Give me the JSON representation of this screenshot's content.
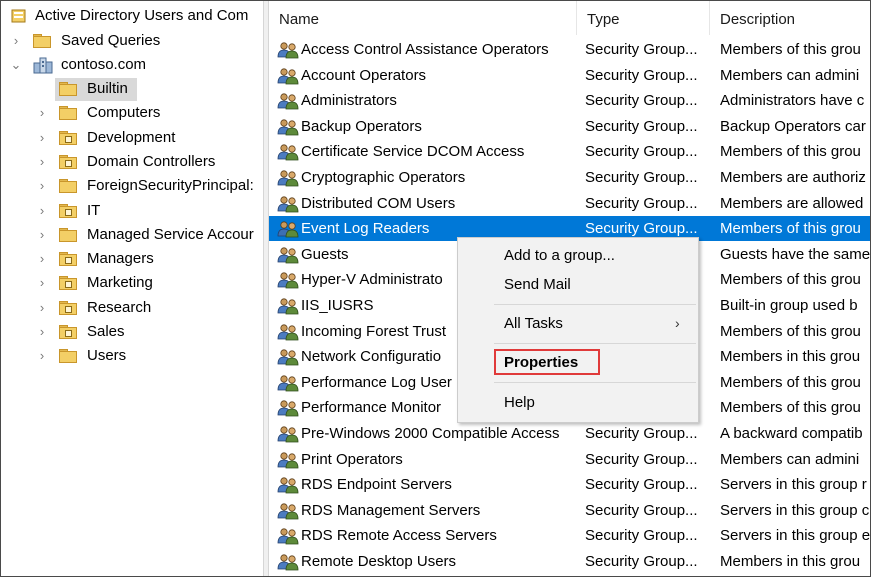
{
  "tree": {
    "root_label": "Active Directory Users and Com",
    "saved_queries": "Saved Queries",
    "domain": "contoso.com",
    "children": [
      {
        "label": "Builtin",
        "icon": "folder-icon",
        "selected": true
      },
      {
        "label": "Computers",
        "icon": "folder-icon"
      },
      {
        "label": "Development",
        "icon": "ou-folder-icon"
      },
      {
        "label": "Domain Controllers",
        "icon": "ou-folder-icon"
      },
      {
        "label": "ForeignSecurityPrincipal:",
        "icon": "folder-icon"
      },
      {
        "label": "IT",
        "icon": "ou-folder-icon"
      },
      {
        "label": "Managed Service Accour",
        "icon": "folder-icon"
      },
      {
        "label": "Managers",
        "icon": "ou-folder-icon"
      },
      {
        "label": "Marketing",
        "icon": "ou-folder-icon"
      },
      {
        "label": "Research",
        "icon": "ou-folder-icon"
      },
      {
        "label": "Sales",
        "icon": "ou-folder-icon"
      },
      {
        "label": "Users",
        "icon": "folder-icon"
      }
    ]
  },
  "list": {
    "columns": [
      "Name",
      "Type",
      "Description"
    ],
    "rows": [
      {
        "name": "Access Control Assistance Operators",
        "type": "Security Group...",
        "desc": "Members of this grou"
      },
      {
        "name": "Account Operators",
        "type": "Security Group...",
        "desc": "Members can admini"
      },
      {
        "name": "Administrators",
        "type": "Security Group...",
        "desc": "Administrators have c"
      },
      {
        "name": "Backup Operators",
        "type": "Security Group...",
        "desc": "Backup Operators car"
      },
      {
        "name": "Certificate Service DCOM Access",
        "type": "Security Group...",
        "desc": "Members of this grou"
      },
      {
        "name": "Cryptographic Operators",
        "type": "Security Group...",
        "desc": "Members are authoriz"
      },
      {
        "name": "Distributed COM Users",
        "type": "Security Group...",
        "desc": "Members are allowed"
      },
      {
        "name": "Event Log Readers",
        "type": "Security Group...",
        "desc": "Members of this grou",
        "selected": true
      },
      {
        "name": "Guests",
        "type": "",
        "desc": "Guests have the same"
      },
      {
        "name": "Hyper-V Administrato",
        "type": "",
        "desc": "Members of this grou"
      },
      {
        "name": "IIS_IUSRS",
        "type": "",
        "desc": "Built-in group used b"
      },
      {
        "name": "Incoming Forest Trust",
        "type": "",
        "desc": "Members of this grou"
      },
      {
        "name": "Network Configuratio",
        "type": "",
        "desc": "Members in this grou"
      },
      {
        "name": "Performance Log User",
        "type": "",
        "desc": "Members of this grou"
      },
      {
        "name": "Performance Monitor",
        "type": "",
        "desc": "Members of this grou"
      },
      {
        "name": "Pre-Windows 2000 Compatible Access",
        "type": "Security Group...",
        "desc": "A backward compatib"
      },
      {
        "name": "Print Operators",
        "type": "Security Group...",
        "desc": "Members can admini"
      },
      {
        "name": "RDS Endpoint Servers",
        "type": "Security Group...",
        "desc": "Servers in this group r"
      },
      {
        "name": "RDS Management Servers",
        "type": "Security Group...",
        "desc": "Servers in this group c"
      },
      {
        "name": "RDS Remote Access Servers",
        "type": "Security Group...",
        "desc": "Servers in this group e"
      },
      {
        "name": "Remote Desktop Users",
        "type": "Security Group...",
        "desc": "Members in this grou"
      }
    ]
  },
  "context_menu": {
    "add_to_group": "Add to a group...",
    "send_mail": "Send Mail",
    "all_tasks": "All Tasks",
    "properties": "Properties",
    "help": "Help"
  },
  "colors": {
    "selection": "#0078d7",
    "highlight_box": "#e03a3a"
  }
}
